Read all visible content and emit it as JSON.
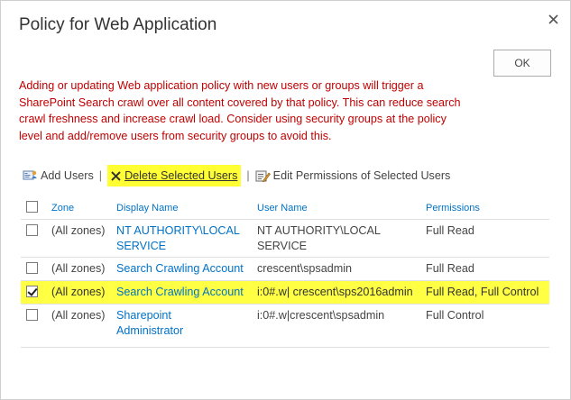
{
  "dialog": {
    "title": "Policy for Web Application",
    "ok_label": "OK",
    "warning": "Adding or updating Web application policy with new users or groups will trigger a SharePoint Search crawl over all content covered by that policy. This can reduce search crawl freshness and increase crawl load. Consider using security groups at the policy level and add/remove users from security groups to avoid this."
  },
  "toolbar": {
    "add_users": "Add Users",
    "separator": "|",
    "delete_selected": "Delete Selected Users",
    "edit_permissions": "Edit Permissions of Selected Users"
  },
  "table": {
    "columns": {
      "zone": "Zone",
      "display_name": "Display Name",
      "user_name": "User Name",
      "permissions": "Permissions"
    },
    "rows": [
      {
        "checked": false,
        "zone": "(All zones)",
        "display_name": "NT AUTHORITY\\LOCAL SERVICE",
        "user_name": "NT AUTHORITY\\LOCAL SERVICE",
        "permissions": "Full Read"
      },
      {
        "checked": false,
        "zone": "(All zones)",
        "display_name": "Search Crawling Account",
        "user_name": "crescent\\spsadmin",
        "permissions": "Full Read"
      },
      {
        "checked": true,
        "zone": "(All zones)",
        "display_name": "Search Crawling Account",
        "user_name": "i:0#.w| crescent\\sps2016admin",
        "permissions": "Full Read, Full Control"
      },
      {
        "checked": false,
        "zone": "(All zones)",
        "display_name": "Sharepoint Administrator",
        "user_name": "i:0#.w|crescent\\spsadmin",
        "permissions": "Full Control"
      }
    ]
  },
  "colors": {
    "warning_text": "#bf0000",
    "link_blue": "#0072c6",
    "highlight_yellow": "#ffff44"
  },
  "icons": {
    "close": "close-icon",
    "add_users": "add-users-icon",
    "delete": "delete-x-icon",
    "edit_permissions": "edit-permissions-icon"
  }
}
